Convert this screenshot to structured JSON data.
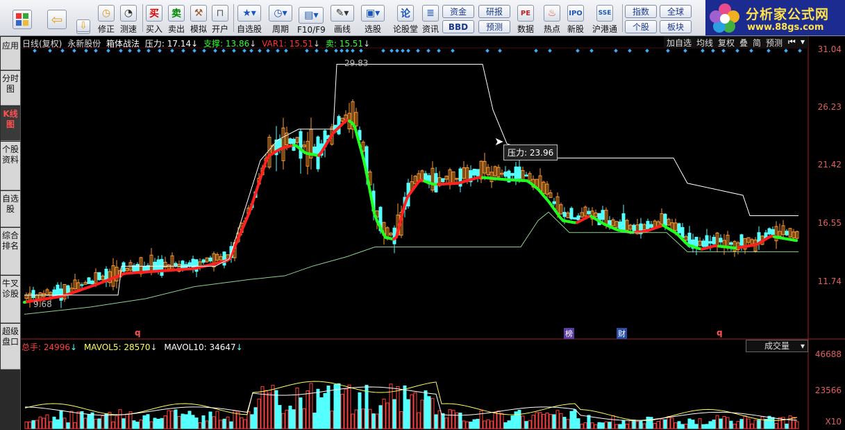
{
  "toolbar": {
    "buttons": [
      {
        "label": "",
        "icon": "apps-grid-icon"
      },
      {
        "label": "",
        "icon": "back-arrow-icon"
      },
      {
        "label": "修正",
        "icon": "clock-icon"
      },
      {
        "label": "测速",
        "icon": "speed-clock-icon"
      },
      {
        "label": "买入",
        "icon": "buy-icon"
      },
      {
        "label": "卖出",
        "icon": "sell-icon"
      },
      {
        "label": "模拟",
        "icon": "hammer-icon"
      },
      {
        "label": "开户",
        "icon": "lock-icon"
      },
      {
        "label": "自选股",
        "icon": "star-box-icon"
      },
      {
        "label": "周期",
        "icon": "period-clock-icon"
      },
      {
        "label": "F10/F9",
        "icon": "window-icon"
      },
      {
        "label": "画线",
        "icon": "pencil-icon"
      },
      {
        "label": "选股",
        "icon": "monitor-icon"
      },
      {
        "label": "论股堂",
        "icon": "discuss-icon"
      },
      {
        "label": "资讯",
        "icon": "news-icon"
      },
      {
        "label": "数据",
        "icon": "pe-icon"
      },
      {
        "label": "热点",
        "icon": "fire-icon"
      },
      {
        "label": "新股",
        "icon": "new-stock-icon"
      },
      {
        "label": "沪港通",
        "icon": "hk-connect-icon"
      }
    ],
    "pills": [
      "资金",
      "研报",
      "BBD",
      "预测",
      "指数",
      "全球",
      "个股",
      "板块"
    ],
    "brand": {
      "title": "分析家公式网",
      "url": "www.88gs.com"
    }
  },
  "left_tabs": [
    "应用",
    "分时图",
    "K线图",
    "个股资料",
    "自选股",
    "综合排名",
    "牛叉诊股",
    "超级盘口"
  ],
  "header": {
    "period": "日线(复权)",
    "stock": "永新股份",
    "indicator": "箱体战法",
    "pressure": "压力: 17.14",
    "support": "支撑: 13.86",
    "var1": "VAR1: 15.51",
    "sell": "卖: 15.51",
    "right_buttons": [
      "加自选",
      "均线",
      "复权",
      "叠",
      "简",
      "预测"
    ]
  },
  "price_axis": [
    "31.04",
    "26.23",
    "21.42",
    "16.55",
    "11.74"
  ],
  "annotations": {
    "high": "29.83",
    "low": "9.68",
    "tooltip": "压力: 23.96",
    "markers": [
      "q",
      "榜",
      "财",
      "q"
    ]
  },
  "volume": {
    "total": "总手: 24996",
    "mavol5": "MAVOL5: 28570",
    "mavol10": "MAVOL10: 34647",
    "dropdown": "成交量",
    "axis": [
      "46688",
      "23566",
      "X10"
    ]
  },
  "colors": {
    "up": "#ff4040",
    "down": "#54ffff",
    "red_line": "#ff2020",
    "green_line": "#20ff20",
    "support": "#8fd08f",
    "pressure": "#ffffff"
  }
}
